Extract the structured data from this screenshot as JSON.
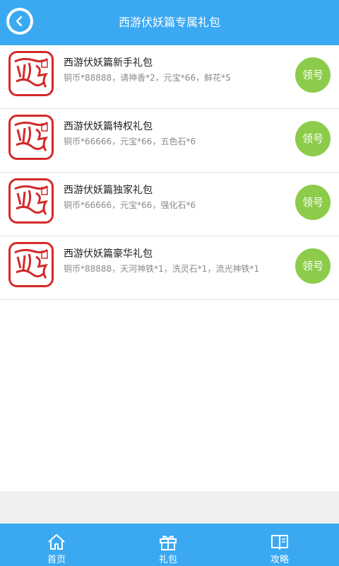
{
  "header": {
    "title": "西游伏妖篇专属礼包",
    "back_icon": "chevron-left-icon"
  },
  "gifts": [
    {
      "name": "西游伏妖篇新手礼包",
      "desc": "铜币*88888，请神香*2，元宝*66，鲜花*5",
      "button": "领号"
    },
    {
      "name": "西游伏妖篇特权礼包",
      "desc": "铜币*66666，元宝*66，五色石*6",
      "button": "领号"
    },
    {
      "name": "西游伏妖篇独家礼包",
      "desc": "铜币*66666，元宝*66，强化石*6",
      "button": "领号"
    },
    {
      "name": "西游伏妖篇豪华礼包",
      "desc": "铜币*88888，天河神铁*1，洗灵石*1，流光神铁*1",
      "button": "领号"
    }
  ],
  "tabs": [
    {
      "label": "首页",
      "icon": "home-icon"
    },
    {
      "label": "礼包",
      "icon": "gift-icon"
    },
    {
      "label": "攻略",
      "icon": "book-icon"
    }
  ],
  "colors": {
    "header": "#3aa9f2",
    "button": "#8ccc4a",
    "logo_red": "#d32a2a"
  }
}
